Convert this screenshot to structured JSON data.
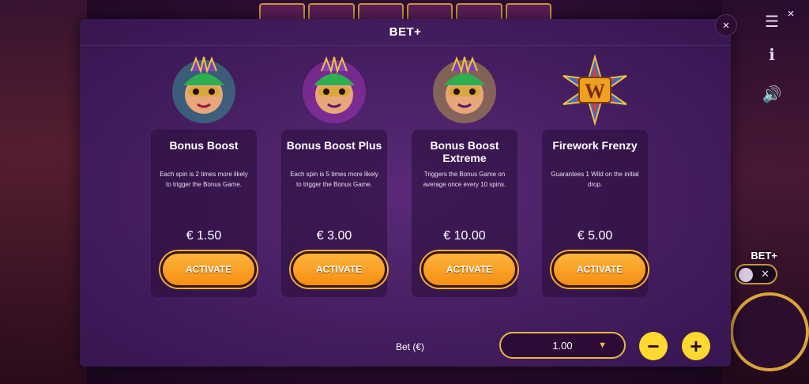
{
  "modal": {
    "title": "BET+"
  },
  "features": [
    {
      "name": "Bonus Boost",
      "description": "Each spin is 2 times more likely to trigger the Bonus Game.",
      "price": "€ 1.50",
      "button": "ACTIVATE",
      "icon": "mask-green-icon",
      "glow": "#2fd6b0"
    },
    {
      "name": "Bonus Boost Plus",
      "description": "Each spin is 5 times more likely to trigger the Bonus Game.",
      "price": "€ 3.00",
      "button": "ACTIVATE",
      "icon": "mask-purple-icon",
      "glow": "#d040e0"
    },
    {
      "name": "Bonus Boost Extreme",
      "description": "Triggers the Bonus Game on average once every 10 spins.",
      "price": "€ 10.00",
      "button": "ACTIVATE",
      "icon": "mask-gold-icon",
      "glow": "#f4e040"
    },
    {
      "name": "Firework Frenzy",
      "description": "Guarantees 1 Wild on the initial drop.",
      "price": "€ 5.00",
      "button": "ACTIVATE",
      "icon": "wild-w-icon",
      "glow": "#f0a020"
    }
  ],
  "bet": {
    "label": "Bet (€)",
    "value": "1.00",
    "minus": "−",
    "plus": "+"
  },
  "side": {
    "betplus_label": "BET+",
    "close_symbol": "×"
  },
  "colors": {
    "accent": "#f48f12",
    "gold": "#e8b647",
    "modal_bg": "#431d5e"
  }
}
